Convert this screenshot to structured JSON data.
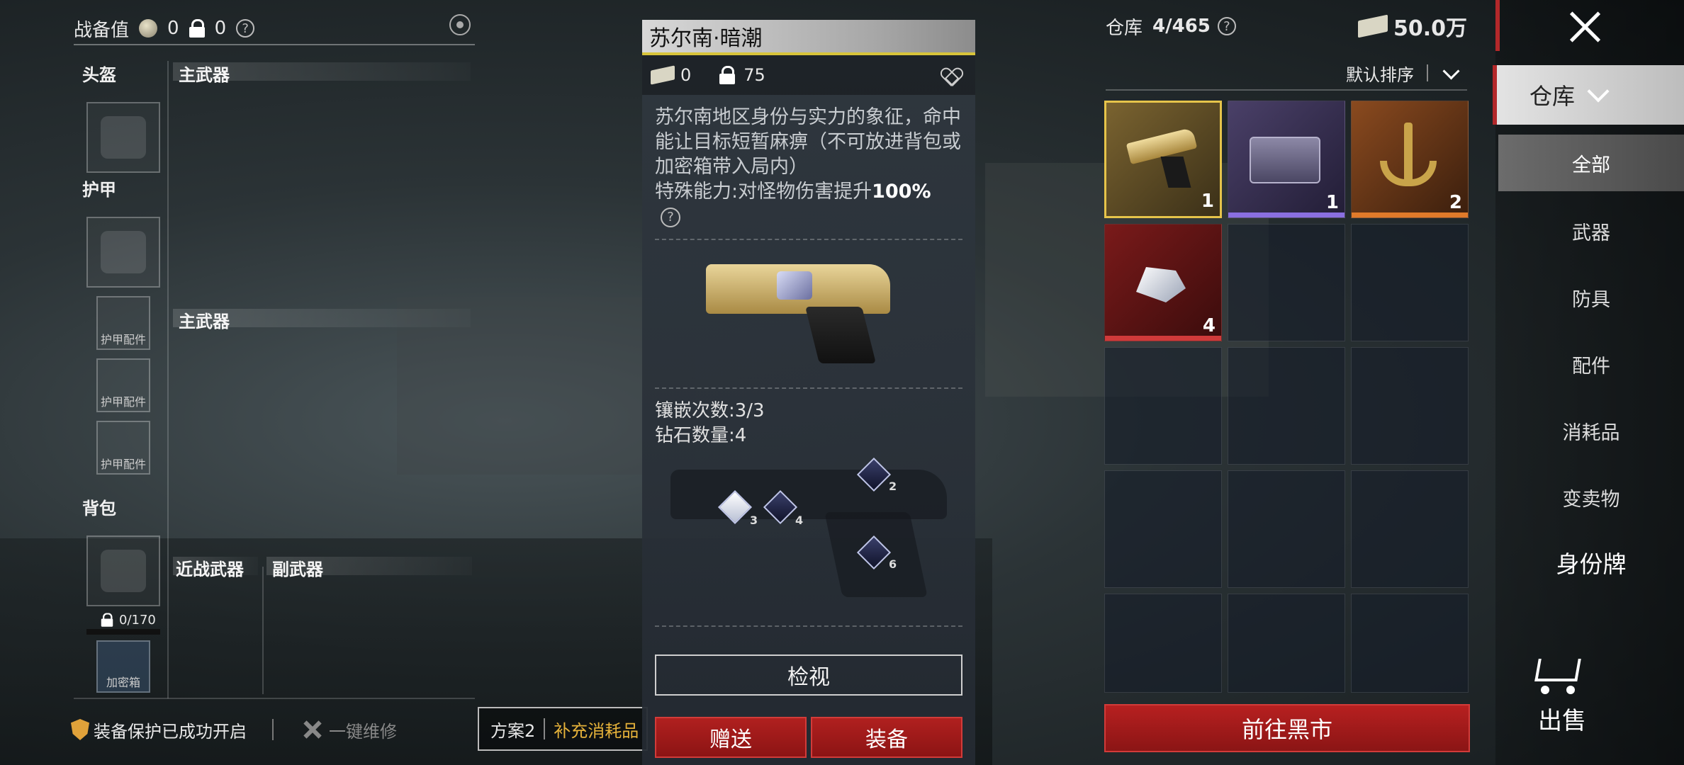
{
  "header": {
    "gear_label": "战备值",
    "coin_count": "0",
    "lock_count": "0",
    "help": "?"
  },
  "loadout": {
    "helmet": "头盔",
    "armor": "护甲",
    "backpack": "背包",
    "primary_1": "主武器",
    "primary_2": "主武器",
    "melee": "近战武器",
    "secondary": "副武器",
    "armor_accessory": "护甲配件",
    "backpack_capacity": "0/170",
    "safe_box": "加密箱"
  },
  "bottom": {
    "protect_text": "装备保护已成功开启",
    "repair_text": "一键维修",
    "plan_label": "方案2",
    "supply_label": "补充消耗品"
  },
  "detail": {
    "title": "苏尔南·暗潮",
    "price_cash": "0",
    "price_lock": "75",
    "description": "苏尔南地区身份与实力的象征，命中能让目标短暂麻痹（不可放进背包或加密箱带入局内）",
    "special_prefix": "特殊能力:对怪物伤害提升",
    "special_value": "100%",
    "inlay_count": "镶嵌次数:3/3",
    "diamond_count": "钻石数量:4",
    "gem_labels": [
      "2",
      "3",
      "4",
      "6"
    ],
    "view_button": "检视",
    "gift_button": "赠送",
    "equip_button": "装备"
  },
  "inventory": {
    "label": "仓库",
    "capacity": "4/465",
    "money": "50.0万",
    "sort_label": "默认排序",
    "items": [
      {
        "name": "苏尔南·暗潮",
        "qty": "1",
        "rarity_color": "#e6c44a"
      },
      {
        "name": "purple-case",
        "qty": "1",
        "rarity_color": "#8a6fe0"
      },
      {
        "name": "gold-anchor",
        "qty": "2",
        "rarity_color": "#e07a2a"
      },
      {
        "name": "diamonds",
        "qty": "4",
        "rarity_color": "#d03a3a"
      }
    ],
    "market_button": "前往黑市"
  },
  "sidebar": {
    "tab": "仓库",
    "items": [
      "全部",
      "武器",
      "防具",
      "配件",
      "消耗品",
      "变卖物",
      "身份牌"
    ],
    "sell": "出售"
  }
}
